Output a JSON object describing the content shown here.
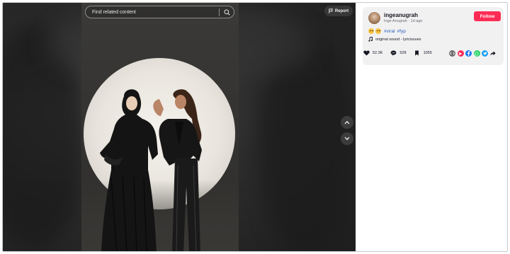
{
  "search": {
    "placeholder": "Find related content"
  },
  "report": {
    "label": "Report"
  },
  "author": {
    "username": "ingeanugrah",
    "display_name": "Inge Anugrah",
    "separator": "·",
    "posted": "1d ago"
  },
  "follow": {
    "label": "Follow"
  },
  "caption": {
    "emojis": [
      "grinning-face-emoji",
      "grinning-face-emoji"
    ],
    "hashtags": [
      "#viral",
      "#fyp"
    ]
  },
  "music": {
    "label": "original sound - lyricissues"
  },
  "stats": {
    "likes": "52.3K",
    "comments": "528",
    "saves": "1055"
  },
  "share_targets": [
    {
      "icon": "embed-icon",
      "color": "#6b6b6b"
    },
    {
      "icon": "send-icon",
      "color": "#fe2c55"
    },
    {
      "icon": "facebook-icon",
      "color": "#1877f2"
    },
    {
      "icon": "whatsapp-icon",
      "color": "#25d366"
    },
    {
      "icon": "twitter-icon",
      "color": "#1da1f2"
    },
    {
      "icon": "share-arrow-icon",
      "color": "#161823"
    }
  ],
  "colors": {
    "accent": "#fe2c55",
    "hashtag": "#2b5db9"
  }
}
